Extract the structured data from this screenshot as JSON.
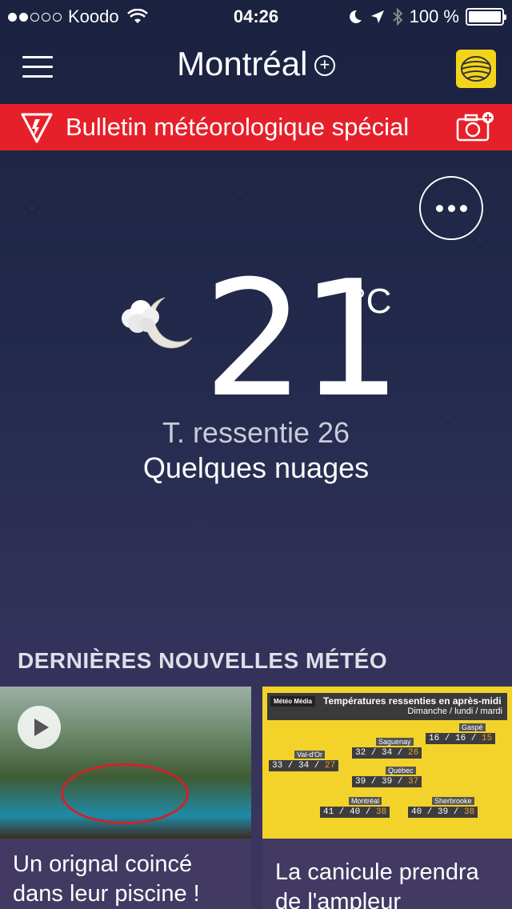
{
  "status_bar": {
    "carrier": "Koodo",
    "time": "04:26",
    "battery": "100 %"
  },
  "header": {
    "city": "Montréal",
    "add_symbol": "+"
  },
  "alert": {
    "text": "Bulletin météorologique spécial",
    "color": "#e6202a"
  },
  "current": {
    "temperature": "21",
    "unit": "°C",
    "feels_like": "T. ressentie 26",
    "condition": "Quelques nuages",
    "icon": "night-partly-cloudy-icon"
  },
  "news": {
    "section_title": "DERNIÈRES NOUVELLES MÉTÉO",
    "items": [
      {
        "caption": "Un orignal coincé dans leur piscine !",
        "has_video": true
      },
      {
        "caption": "La canicule prendra de l'ampleur",
        "map": {
          "logo": "Météo Média",
          "title": "Températures ressenties en après-midi",
          "subtitle": "Dimanche / lundi / mardi",
          "cities": [
            {
              "name": "Val-d'Or",
              "values": "33 / 34 / ",
              "hl": "27"
            },
            {
              "name": "Saguenay",
              "values": "32 / 34 / ",
              "hl": "26"
            },
            {
              "name": "Gaspé",
              "values": "16 / 16 / ",
              "hl": "15"
            },
            {
              "name": "Québec",
              "values": "39 / 39 / ",
              "hl": "37"
            },
            {
              "name": "Montréal",
              "values": "41 / 40 / ",
              "hl": "38"
            },
            {
              "name": "Sherbrooke",
              "values": "40 / 39 / ",
              "hl": "38"
            }
          ]
        }
      }
    ]
  }
}
